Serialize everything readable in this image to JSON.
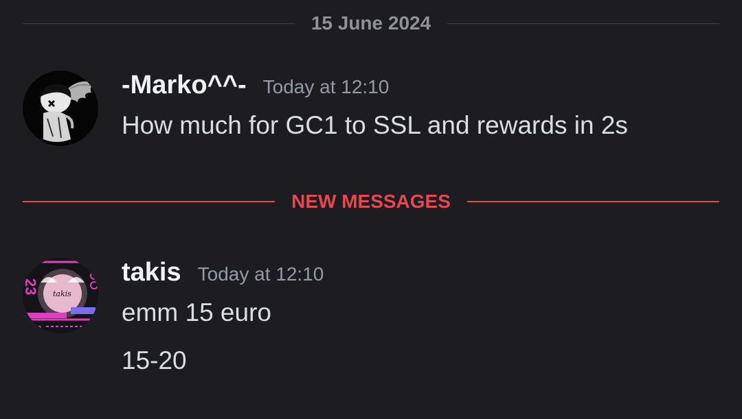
{
  "date_divider": {
    "label": "15 June 2024"
  },
  "new_divider": {
    "label": "NEW MESSAGES"
  },
  "messages": [
    {
      "username": "-Marko^^-",
      "timestamp": "Today at 12:10",
      "lines": [
        "How much for GC1 to SSL and rewards in 2s"
      ]
    },
    {
      "username": "takis",
      "timestamp": "Today at 12:10",
      "avatar_text": "takis",
      "lines": [
        "emm 15 euro",
        "15-20"
      ]
    }
  ],
  "colors": {
    "background": "#1c1c21",
    "new_messages": "#e5484d",
    "divider": "#3f4147",
    "timestamp": "#949ba4",
    "avatar_accent": "#e040c0"
  }
}
